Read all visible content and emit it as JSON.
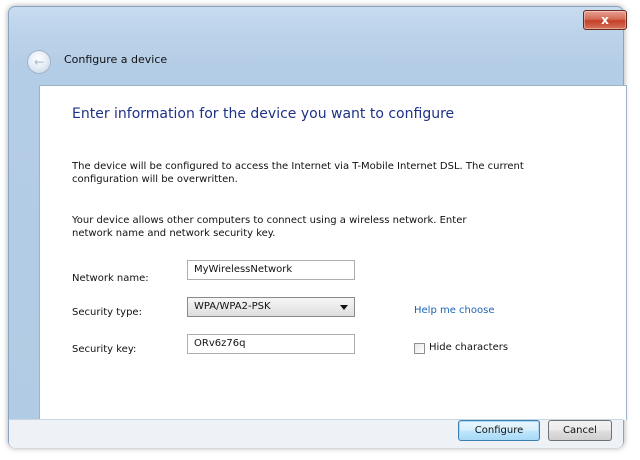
{
  "window": {
    "title": "Configure a device",
    "close_label": "x"
  },
  "nav": {
    "back_glyph": "←"
  },
  "content": {
    "heading": "Enter information for the device you want to configure",
    "paragraph1": "The device will be configured to access the Internet via T-Mobile Internet DSL. The current configuration will be overwritten.",
    "paragraph2": "Your device allows other computers to connect using a wireless network. Enter network name and network security key."
  },
  "form": {
    "network_name_label": "Network name:",
    "network_name_value": "MyWirelessNetwork",
    "security_type_label": "Security type:",
    "security_type_value": "WPA/WPA2-PSK",
    "help_link": "Help me choose",
    "security_key_label": "Security key:",
    "security_key_value": "ORv6z76q",
    "hide_characters_label": "Hide characters",
    "hide_characters_checked": false
  },
  "buttons": {
    "configure": "Configure",
    "cancel": "Cancel"
  },
  "colors": {
    "heading": "#1e3287",
    "link": "#1e64b4",
    "close_button": "#c43f27"
  }
}
